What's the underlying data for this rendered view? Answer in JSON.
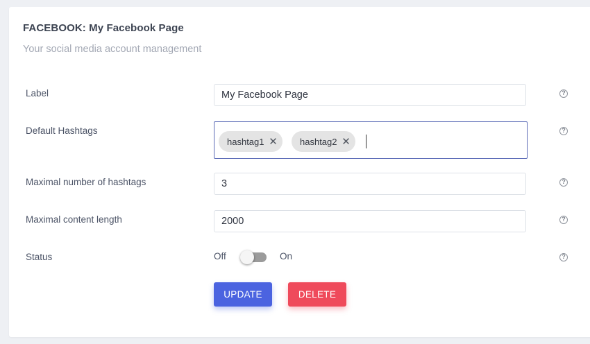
{
  "header": {
    "title": "FACEBOOK: My Facebook Page",
    "subtitle": "Your social media account management"
  },
  "form": {
    "label": {
      "label": "Label",
      "value": "My Facebook Page",
      "help": "?"
    },
    "hashtags": {
      "label": "Default Hashtags",
      "tags": [
        "hashtag1",
        "hashtag2"
      ],
      "remove": "✕",
      "help": "?"
    },
    "max_hashtags": {
      "label": "Maximal number of hashtags",
      "value": "3",
      "help": "?"
    },
    "max_length": {
      "label": "Maximal content length",
      "value": "2000",
      "help": "?"
    },
    "status": {
      "label": "Status",
      "off": "Off",
      "on": "On",
      "enabled": false,
      "help": "?"
    }
  },
  "actions": {
    "update": "UPDATE",
    "delete": "DELETE"
  },
  "colors": {
    "update": "#4b63e0",
    "delete": "#ef4a5b",
    "focus_border": "#5a6ab6"
  }
}
